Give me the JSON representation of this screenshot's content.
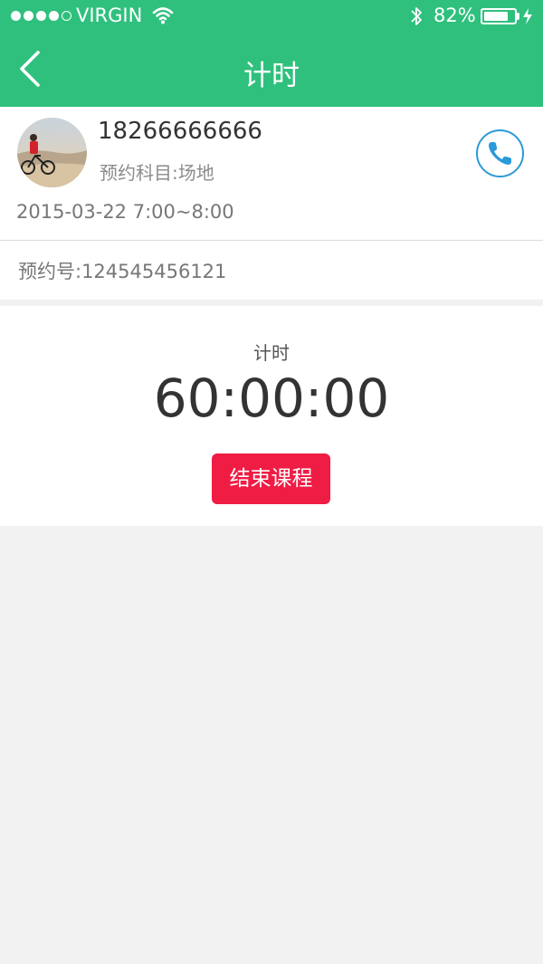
{
  "status_bar": {
    "carrier": "VIRGIN",
    "battery_percent": "82%",
    "battery_level": 0.82,
    "signal_bars_filled": 4,
    "signal_bars_total": 5
  },
  "nav": {
    "title": "计时",
    "back_icon": "chevron-left-icon"
  },
  "appointment": {
    "phone_number": "18266666666",
    "subject": "预约科目:场地",
    "datetime": "2015-03-22 7:00~8:00",
    "order_number": "预约号:124545456121",
    "call_icon": "phone-icon"
  },
  "timer": {
    "label": "计时",
    "value": "60:00:00",
    "end_button_label": "结束课程"
  },
  "colors": {
    "header": "#2fc07e",
    "call_accent": "#2a9ad8",
    "end_button": "#ef1c44",
    "background": "#f2f2f2"
  }
}
